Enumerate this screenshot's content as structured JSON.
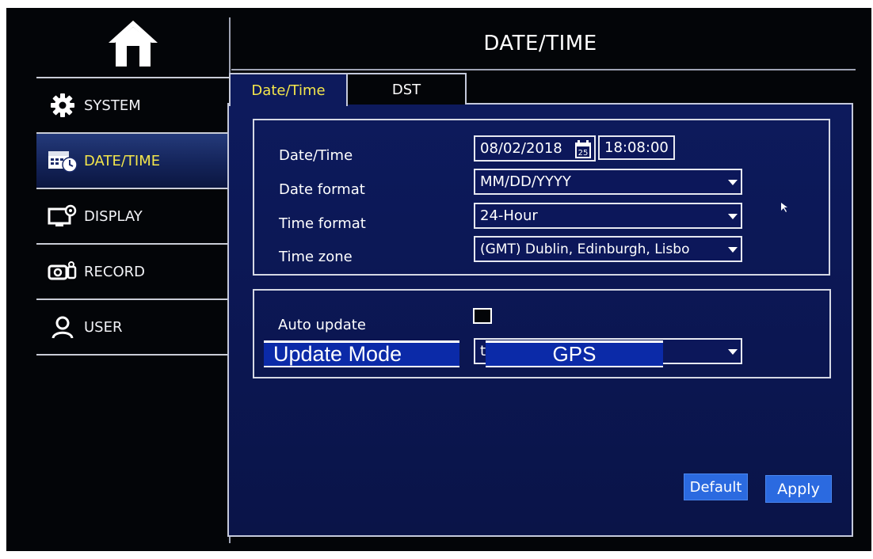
{
  "header": {
    "title": "DATE/TIME"
  },
  "sidebar": {
    "home_icon": "home-icon",
    "items": [
      {
        "label": "SYSTEM",
        "icon": "gear-icon"
      },
      {
        "label": "DATE/TIME",
        "icon": "calendar-clock-icon",
        "active": true
      },
      {
        "label": "DISPLAY",
        "icon": "monitor-settings-icon"
      },
      {
        "label": "RECORD",
        "icon": "camcorder-icon"
      },
      {
        "label": "USER",
        "icon": "user-icon"
      }
    ]
  },
  "tabs": [
    {
      "label": "Date/Time",
      "active": true
    },
    {
      "label": "DST",
      "active": false
    }
  ],
  "form": {
    "date_time_label": "Date/Time",
    "date_value": "08/02/2018",
    "calendar_day": "25",
    "time_value": "18:08:00",
    "date_format_label": "Date format",
    "date_format_value": "MM/DD/YYYY",
    "time_format_label": "Time format",
    "time_format_value": "24-Hour",
    "time_zone_label": "Time zone",
    "time_zone_value": "(GMT) Dublin, Edinburgh, Lisbo",
    "auto_update_label": "Auto update",
    "auto_update_checked": false,
    "update_mode_label": "Update Mode",
    "update_mode_prefix": "t",
    "update_mode_value": "GPS"
  },
  "buttons": {
    "default": "Default",
    "apply": "Apply"
  },
  "colors": {
    "accent_yellow": "#f4e64b",
    "panel_blue": "#0d1a5c",
    "button_blue": "#2b6ae0",
    "overlay_blue": "#0b2aa8",
    "background": "#030508"
  }
}
